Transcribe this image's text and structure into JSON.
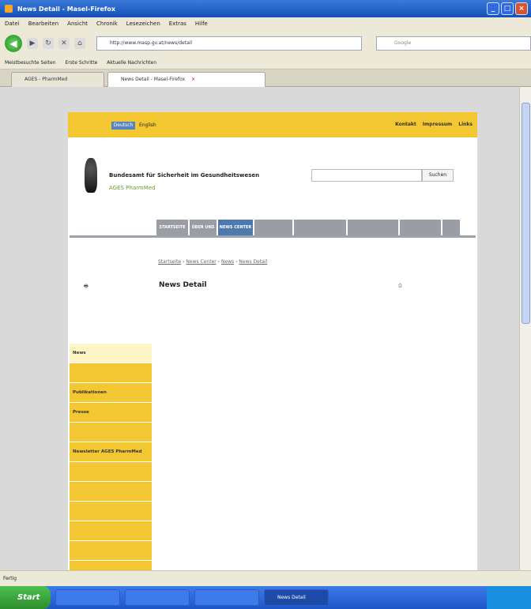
{
  "window": {
    "title": "News Detail - Masel-Firefox",
    "controls": [
      "_",
      "□",
      "×"
    ]
  },
  "menu": [
    "Datei",
    "Bearbeiten",
    "Ansicht",
    "Chronik",
    "Lesezeichen",
    "Extras",
    "Hilfe"
  ],
  "nav": {
    "url": "http://www.masp.gv.at/news/detail",
    "search_placeholder": "Google"
  },
  "bookmarks": [
    "Meistbesuchte Seiten",
    "Erste Schritte",
    "Aktuelle Nachrichten"
  ],
  "tabs": [
    {
      "label": "AGES - PharmMed"
    },
    {
      "label": "News Detail - Masel-Firefox",
      "close": "×"
    }
  ],
  "site": {
    "lang_active": "Deutsch",
    "lang_other": "English",
    "top_links": [
      "Kontakt",
      "Impressum",
      "Links"
    ],
    "org_name": "Bundesamt für Sicherheit im Gesundheitswesen",
    "org_sub": "AGES PharmMed",
    "search_button": "Suchen",
    "main_nav": [
      {
        "label": "STARTSEITE",
        "active": false
      },
      {
        "label": "ÜBER UNS",
        "active": false
      },
      {
        "label": "NEWS CENTER",
        "active": true
      },
      {
        "label": "",
        "active": false
      },
      {
        "label": "",
        "active": false
      },
      {
        "label": "",
        "active": false
      },
      {
        "label": "",
        "active": false
      },
      {
        "label": "",
        "active": false
      }
    ],
    "breadcrumb": [
      "Startseite",
      "News Center",
      "News",
      "News Detail"
    ],
    "print_link": "",
    "page_title": "News Detail",
    "page_tools": "",
    "sidebar": [
      {
        "label": "News",
        "active": true
      },
      {
        "label": "",
        "active": false
      },
      {
        "label": "Publikationen",
        "active": false
      },
      {
        "label": "Presse",
        "active": false
      },
      {
        "label": "",
        "active": false
      },
      {
        "label": "Newsletter AGES PharmMed",
        "active": false
      },
      {
        "label": "",
        "active": false
      },
      {
        "label": "",
        "active": false
      },
      {
        "label": "",
        "active": false
      },
      {
        "label": "",
        "active": false
      },
      {
        "label": "",
        "active": false
      },
      {
        "label": "",
        "active": false
      }
    ],
    "article": {
      "title": "",
      "meta": "",
      "body": "",
      "subheading": ""
    }
  },
  "statusbar": "Fertig",
  "taskbar": {
    "start": "Start",
    "items": [
      {
        "label": "",
        "active": false
      },
      {
        "label": "",
        "active": false
      },
      {
        "label": "",
        "active": false
      },
      {
        "label": "News Detail",
        "active": true
      }
    ]
  }
}
